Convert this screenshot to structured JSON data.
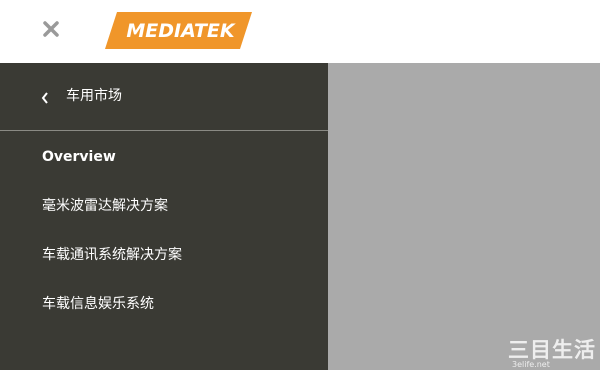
{
  "header": {
    "close_icon": "close-icon",
    "logo_text": "MEDIATEK",
    "logo_color": "#f0962a"
  },
  "sidebar": {
    "background": "#3a3a34",
    "back": {
      "icon": "chevron-left-icon",
      "label": "车用市场"
    },
    "items": [
      {
        "label": "Overview",
        "active": true
      },
      {
        "label": "毫米波雷达解决方案",
        "active": false
      },
      {
        "label": "车载通讯系统解决方案",
        "active": false
      },
      {
        "label": "车载信息娱乐系统",
        "active": false
      }
    ]
  },
  "overlay": {
    "color": "#aaaaaa"
  },
  "watermark": {
    "title": "三目生活",
    "url": "3elife.net"
  }
}
